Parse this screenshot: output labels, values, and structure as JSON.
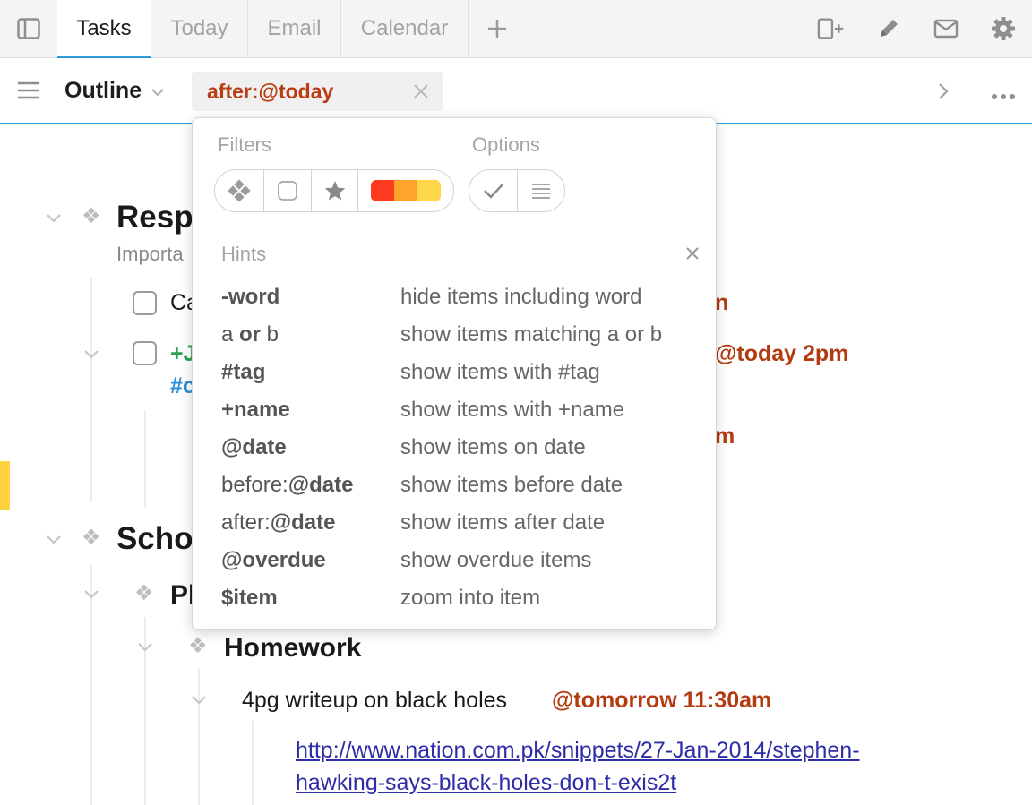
{
  "tabs": {
    "items": [
      {
        "label": "Tasks",
        "active": true
      },
      {
        "label": "Today",
        "active": false
      },
      {
        "label": "Email",
        "active": false
      },
      {
        "label": "Calendar",
        "active": false
      }
    ]
  },
  "toolbar": {
    "title": "Outline",
    "search_value": "after:@today"
  },
  "popover": {
    "filters_label": "Filters",
    "options_label": "Options",
    "hints_label": "Hints",
    "priority_colors": [
      "#ff3b1f",
      "#ffa32b",
      "#ffd84a"
    ],
    "hints": [
      {
        "key_pre": "",
        "key_bold": "-word",
        "key_mid": "",
        "key_post": "",
        "desc": "hide items including word"
      },
      {
        "key_pre": "a ",
        "key_bold": "or",
        "key_mid": "",
        "key_post": " b",
        "desc": "show items matching a or b"
      },
      {
        "key_pre": "",
        "key_bold": "#tag",
        "key_mid": "",
        "key_post": "",
        "desc": "show items with #tag"
      },
      {
        "key_pre": "",
        "key_bold": "+name",
        "key_mid": "",
        "key_post": "",
        "desc": "show items with +name"
      },
      {
        "key_pre": "",
        "key_bold": "@date",
        "key_mid": "",
        "key_post": "",
        "desc": "show items on date"
      },
      {
        "key_pre": "before:",
        "key_bold": "@date",
        "key_mid": "",
        "key_post": "",
        "desc": "show items before date"
      },
      {
        "key_pre": "after:",
        "key_bold": "@date",
        "key_mid": "",
        "key_post": "",
        "desc": "show items after date"
      },
      {
        "key_pre": "",
        "key_bold": "@overdue",
        "key_mid": "",
        "key_post": "",
        "desc": "show overdue items"
      },
      {
        "key_pre": "",
        "key_bold": "$item",
        "key_mid": "",
        "key_post": "",
        "desc": "zoom into item"
      }
    ]
  },
  "outline": {
    "section1_title": "Resp",
    "section1_sub": "Importa",
    "item1_text": "Ca",
    "item1_tag_tail": "n",
    "item2_person": "+J",
    "item2_hashtag": "#c",
    "item2_date": "@today 2pm",
    "item3_tag_tail": "m",
    "section2_title": "Scho",
    "subsection_title": "Pl",
    "homework_title": "Homework",
    "task_text": "4pg writeup on black holes",
    "task_date": "@tomorrow 11:30am",
    "link_line1": "http://www.nation.com.pk/snippets/27-Jan-2014/stephen-",
    "link_line2": "hawking-says-black-holes-don-t-exis2t"
  }
}
